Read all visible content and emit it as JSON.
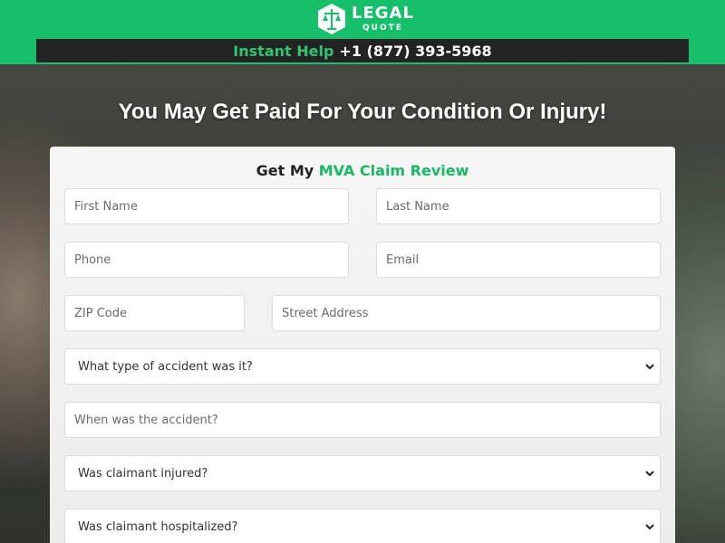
{
  "colors": {
    "brand_green": "#16c06a",
    "accent_green": "#19b866",
    "bar_dark": "#232323"
  },
  "logo": {
    "line1": "LEGAL",
    "line2": "QUOTE",
    "icon": "scales-of-justice-icon"
  },
  "helpbar": {
    "label": "Instant Help",
    "phone": "+1 (877) 393-5968"
  },
  "headline": "You May Get Paid For Your Condition Or Injury!",
  "form": {
    "title_prefix": "Get My",
    "title_accent": "MVA Claim Review",
    "first_name": {
      "placeholder": "First Name"
    },
    "last_name": {
      "placeholder": "Last Name"
    },
    "phone": {
      "placeholder": "Phone"
    },
    "email": {
      "placeholder": "Email"
    },
    "zip": {
      "placeholder": "ZIP Code"
    },
    "street": {
      "placeholder": "Street Address"
    },
    "accident_type": {
      "selected": "What type of accident was it?"
    },
    "accident_date": {
      "placeholder": "When was the accident?"
    },
    "injured": {
      "selected": "Was claimant injured?"
    },
    "hospitalized": {
      "selected": "Was claimant hospitalized?"
    }
  }
}
